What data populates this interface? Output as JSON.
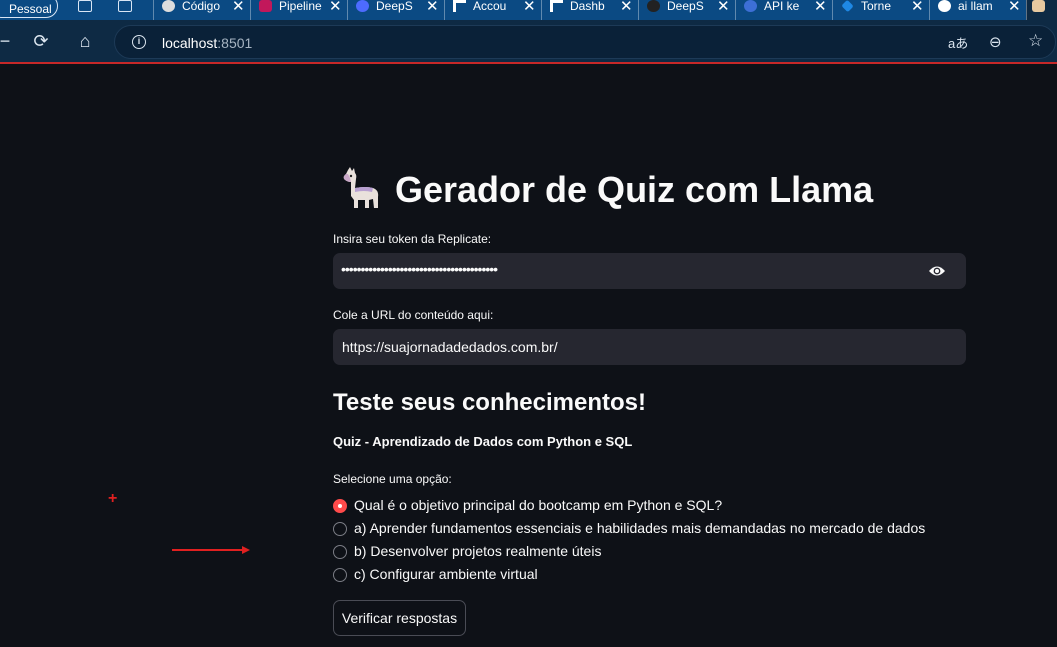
{
  "browser": {
    "profile_label": "Pessoal",
    "tabs": [
      {
        "title": "Código",
        "favicon_color": "#dddddd"
      },
      {
        "title": "Pipeline",
        "favicon_color": "#c2185b"
      },
      {
        "title": "DeepS",
        "favicon_color": "#4d6bfe"
      },
      {
        "title": "Accou",
        "favicon_color": "#ffffff"
      },
      {
        "title": "Dashb",
        "favicon_color": "#ffffff"
      },
      {
        "title": "DeepS",
        "favicon_color": "#222222"
      },
      {
        "title": "API ke",
        "favicon_color": "#3d6fd6"
      },
      {
        "title": "Torne",
        "favicon_color": "#1e88e5"
      },
      {
        "title": "ai llam",
        "favicon_color": "#ffffff"
      }
    ],
    "url_host": "localhost",
    "url_port": ":8501"
  },
  "app": {
    "title": "Gerador de Quiz com Llama",
    "token_label": "Insira seu token da Replicate:",
    "token_value": "••••••••••••••••••••••••••••••••••••••••",
    "url_label": "Cole a URL do conteúdo aqui:",
    "url_value": "https://suajornadadedados.com.br/",
    "subheader": "Teste seus conhecimentos!",
    "quiz_title": "Quiz - Aprendizado de Dados com Python e SQL",
    "radio_label": "Selecione uma opção:",
    "options": [
      "Qual é o objetivo principal do bootcamp em Python e SQL?",
      "a) Aprender fundamentos essenciais e habilidades mais demandadas no mercado de dados",
      "b) Desenvolver projetos realmente úteis",
      "c) Configurar ambiente virtual"
    ],
    "selected_option_index": 0,
    "verify_button": "Verificar respostas"
  },
  "colors": {
    "background": "#0e1117",
    "input_bg": "#262730",
    "accent_red": "#ff4b4b",
    "chrome_tabstrip": "#0b4a83",
    "chrome_toolbar": "#0e2a44"
  }
}
